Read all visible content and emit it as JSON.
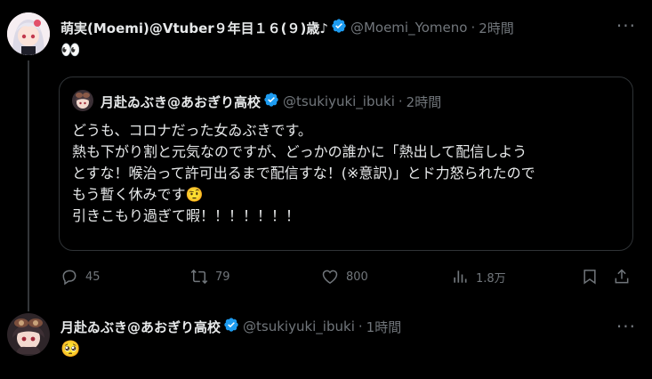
{
  "main_tweet": {
    "display_name": "萌実(Moemi)@Vtuber９年目１６(９)歳♪",
    "handle": "@Moemi_Yomeno",
    "separator": "·",
    "time": "2時間",
    "more_label": "···",
    "text": "👀"
  },
  "quoted_tweet": {
    "display_name": "月赴ゐぶき@あおぎり高校",
    "handle": "@tsukiyuki_ibuki",
    "separator": "·",
    "time": "2時間",
    "lines": [
      "どうも、コロナだった女ゐぶきです。",
      "熱も下がり割と元気なのですが、どっかの誰かに「熱出して配信しよう",
      "とすな！喉治って許可出るまで配信すな！(※意訳)」とド力怒られたので",
      "もう暫く休みです🤨",
      "引きこもり過ぎて暇！！！！！！！"
    ]
  },
  "actions": {
    "replies": "45",
    "retweets": "79",
    "likes": "800",
    "views": "1.8万"
  },
  "reply_tweet": {
    "display_name": "月赴ゐぶき@あおぎり高校",
    "handle": "@tsukiyuki_ibuki",
    "separator": "·",
    "time": "1時間",
    "more_label": "···",
    "text": "🥺"
  },
  "colors": {
    "background": "#000000",
    "text": "#e7e9ea",
    "muted": "#71767b",
    "verified": "#1d9bf0",
    "border": "#2f3336"
  }
}
